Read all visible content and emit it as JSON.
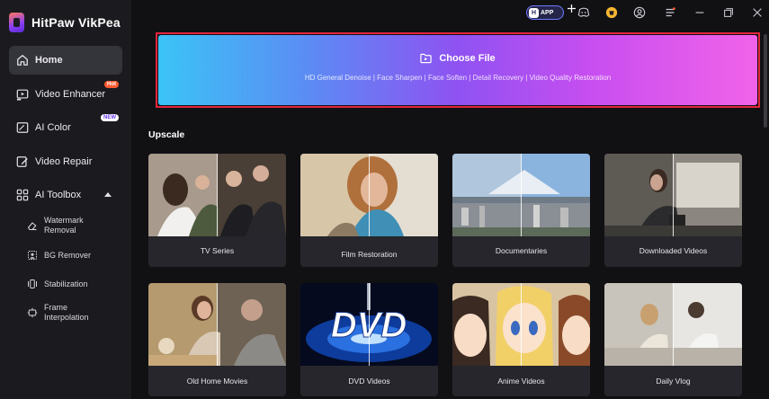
{
  "app": {
    "title": "HitPaw VikPea"
  },
  "sidebar": {
    "items": [
      {
        "label": "Home",
        "icon": "home-icon",
        "active": true
      },
      {
        "label": "Video Enhancer",
        "icon": "video-enhancer-icon",
        "badge": "Hot"
      },
      {
        "label": "AI Color",
        "icon": "ai-color-icon",
        "badge": "NEW"
      },
      {
        "label": "Video Repair",
        "icon": "video-repair-icon"
      },
      {
        "label": "AI Toolbox",
        "icon": "toolbox-icon",
        "expanded": true
      }
    ],
    "toolbox": [
      {
        "label": "Watermark Removal",
        "icon": "eraser-icon"
      },
      {
        "label": "BG Remover",
        "icon": "bg-remover-icon"
      },
      {
        "label": "Stabilization",
        "icon": "stabilization-icon"
      },
      {
        "label": "Frame Interpolation",
        "icon": "frame-interpolation-icon"
      }
    ]
  },
  "topbar": {
    "app_label": "APP",
    "app_logo": "H"
  },
  "dropzone": {
    "label": "Choose File",
    "features": "HD General Denoise | Face Sharpen | Face Soften | Detail Recovery | Video Quality Restoration"
  },
  "upscale": {
    "title": "Upscale",
    "cards": [
      {
        "label": "TV Series"
      },
      {
        "label": "Film Restoration"
      },
      {
        "label": "Documentaries"
      },
      {
        "label": "Downloaded Videos"
      },
      {
        "label": "Old Home Movies"
      },
      {
        "label": "DVD Videos"
      },
      {
        "label": "Anime Videos"
      },
      {
        "label": "Daily Vlog"
      }
    ]
  },
  "colors": {
    "accent_start": "#3bc4f6",
    "accent_end": "#f163e9",
    "highlight_border": "#e2253c",
    "sidebar_bg": "#1b1b1f"
  }
}
